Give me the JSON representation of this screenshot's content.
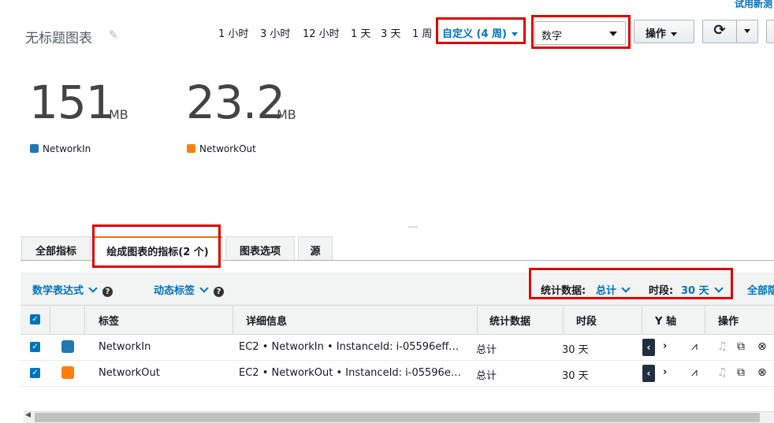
{
  "header": {
    "top_link": "试用新测",
    "title": "无标题图表",
    "time_ranges": [
      "1 小时",
      "3 小时",
      "12 小时",
      "1 天",
      "3 天",
      "1 周"
    ],
    "custom_range": "自定义 (4 周)",
    "view_select": "数字",
    "actions_button": "操作"
  },
  "metrics": [
    {
      "value": "151",
      "unit": "MB",
      "legend": "NetworkIn",
      "color": "#1f77b4"
    },
    {
      "value": "23.2",
      "unit": "MB",
      "legend": "NetworkOut",
      "color": "#ff7f0e"
    }
  ],
  "resize_handle": "---",
  "tabs": [
    "全部指标",
    "绘成图表的指标(2 个)",
    "图表选项",
    "源"
  ],
  "toolbar": {
    "math_expression": "数学表达式",
    "dynamic_labels": "动态标签",
    "statistic_label": "统计数据:",
    "statistic_value": "总计",
    "period_label": "时段:",
    "period_value": "30 天",
    "all_link": "全部隐"
  },
  "table": {
    "headers": [
      "标签",
      "详细信息",
      "统计数据",
      "时段",
      "Y 轴",
      "操作"
    ],
    "rows": [
      {
        "label": "NetworkIn",
        "details": "EC2 • NetworkIn • InstanceId: i-05596eff…",
        "statistic": "总计",
        "period": "30 天",
        "color": "#1f77b4"
      },
      {
        "label": "NetworkOut",
        "details": "EC2 • NetworkOut • InstanceId: i-05596e…",
        "statistic": "总计",
        "period": "30 天",
        "color": "#ff7f0e"
      }
    ]
  },
  "colors": {
    "accent": "#0073bb",
    "highlight": "#e00000",
    "active_tab": "#ec7211"
  }
}
